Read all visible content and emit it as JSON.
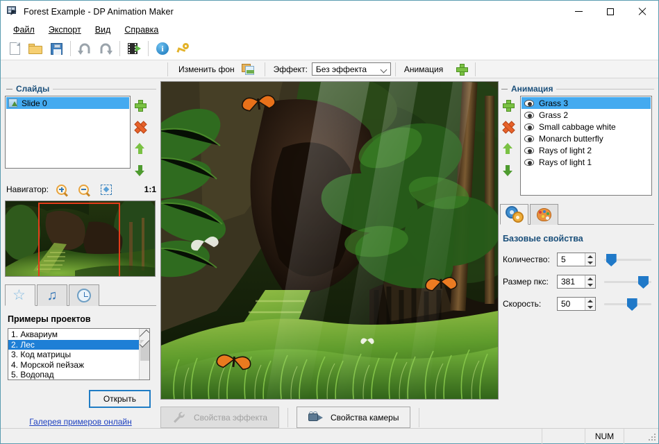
{
  "window": {
    "title": "Forest Example - DP Animation Maker",
    "app_icon": "film-camera-icon",
    "minimize": "—",
    "maximize": "☐",
    "close": "✕"
  },
  "menu": {
    "items": [
      {
        "label": "Файл",
        "accel": "Ф"
      },
      {
        "label": "Экспорт",
        "accel": "Э"
      },
      {
        "label": "Вид",
        "accel": "В"
      },
      {
        "label": "Справка",
        "accel": "С"
      }
    ]
  },
  "toolbar": {
    "buttons": [
      {
        "name": "new-file-icon"
      },
      {
        "name": "open-folder-icon"
      },
      {
        "name": "save-disk-icon"
      },
      {
        "name": "undo-icon"
      },
      {
        "name": "redo-icon"
      },
      {
        "name": "export-video-icon"
      },
      {
        "name": "info-icon",
        "glyph": "i"
      },
      {
        "name": "key-icon"
      }
    ]
  },
  "toolbar2": {
    "change_background": "Изменить фон",
    "effect_label": "Эффект:",
    "effect_value": "Без эффекта",
    "effect_options": [
      "Без эффекта"
    ],
    "animation_label": "Анимация"
  },
  "slides": {
    "group_title": "Слайды",
    "items": [
      {
        "label": "Slide 0",
        "selected": true
      }
    ]
  },
  "navigator": {
    "label": "Навигатор:",
    "zoom_ratio": "1:1"
  },
  "left_tabs": [
    {
      "name": "tab-examples",
      "icon": "star-icon",
      "active": true
    },
    {
      "name": "tab-music",
      "icon": "music-note-icon",
      "active": false
    },
    {
      "name": "tab-timer",
      "icon": "clock-icon",
      "active": false
    }
  ],
  "examples": {
    "title": "Примеры проектов",
    "items": [
      {
        "label": "1. Аквариум",
        "selected": false
      },
      {
        "label": "2. Лес",
        "selected": true
      },
      {
        "label": "3. Код матрицы",
        "selected": false
      },
      {
        "label": "4. Морской пейзаж",
        "selected": false
      },
      {
        "label": "5. Водопад",
        "selected": false
      }
    ],
    "open_button": "Открыть",
    "gallery_link": "Галерея примеров онлайн"
  },
  "canvas_buttons": {
    "effect_properties": "Свойства эффекта",
    "camera_properties": "Свойства камеры"
  },
  "animations": {
    "group_title": "Анимация",
    "items": [
      {
        "label": "Grass 3",
        "selected": true
      },
      {
        "label": "Grass 2",
        "selected": false
      },
      {
        "label": "Small cabbage white",
        "selected": false
      },
      {
        "label": "Monarch butterfly",
        "selected": false
      },
      {
        "label": "Rays of light 2",
        "selected": false
      },
      {
        "label": "Rays of light 1",
        "selected": false
      }
    ]
  },
  "prop_tabs": [
    {
      "name": "tab-basic-properties",
      "icon": "gears-icon",
      "active": true
    },
    {
      "name": "tab-color-properties",
      "icon": "palette-icon",
      "active": false
    }
  ],
  "properties": {
    "title": "Базовые свойства",
    "rows": [
      {
        "label": "Количество:",
        "value": "5",
        "slider_pct": 4
      },
      {
        "label": "Размер пкс:",
        "value": "381",
        "slider_pct": 72
      },
      {
        "label": "Скорость:",
        "value": "50",
        "slider_pct": 48
      }
    ]
  },
  "statusbar": {
    "num_lock": "NUM"
  },
  "colors": {
    "accent": "#1e7fd6",
    "selection": "#44aaf0",
    "group_title": "#1a4f7a",
    "window_border": "#5a9cb0",
    "slider": "#2079c8",
    "link": "#1c3fbf",
    "viewport_rect": "#e43b1a"
  }
}
